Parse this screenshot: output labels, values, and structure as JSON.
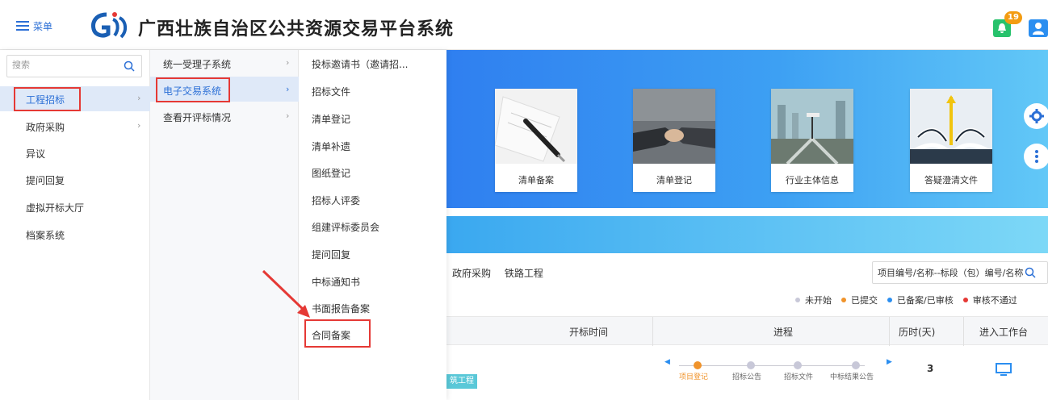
{
  "header": {
    "menu_label": "菜单",
    "site_title": "广西壮族自治区公共资源交易平台系统",
    "notification_count": "19"
  },
  "menu": {
    "search_placeholder": "搜索",
    "level1": [
      "工程招标",
      "政府采购",
      "异议",
      "提问回复",
      "虚拟开标大厅",
      "档案系统"
    ],
    "level2": [
      "统一受理子系统",
      "电子交易系统",
      "查看开评标情况"
    ],
    "level3": [
      "投标邀请书（邀请招...",
      "招标文件",
      "清单登记",
      "清单补遗",
      "图纸登记",
      "招标人评委",
      "组建评标委员会",
      "提问回复",
      "中标通知书",
      "书面报告备案",
      "合同备案"
    ]
  },
  "cards": [
    "清单备案",
    "清单登记",
    "行业主体信息",
    "答疑澄清文件"
  ],
  "tabs": [
    "政府采购",
    "铁路工程"
  ],
  "project_search_placeholder": "项目编号/名称--标段（包）编号/名称",
  "legend": [
    {
      "label": "未开始",
      "color": "#c8c8d8"
    },
    {
      "label": "已提交",
      "color": "#f0932b"
    },
    {
      "label": "已备案/已审核",
      "color": "#2b8ef0"
    },
    {
      "label": "审核不通过",
      "color": "#e53935"
    }
  ],
  "table": {
    "headers": [
      "开标时间",
      "进程",
      "历时(天)",
      "进入工作台"
    ],
    "row": {
      "tag": "筑工程",
      "progress_steps": [
        "项目登记",
        "招标公告",
        "招标文件",
        "中标结果公告"
      ],
      "days": "3"
    }
  },
  "colors": {
    "accent": "#2b6fd6",
    "highlight": "#e53935",
    "banner": "#3da0f3"
  }
}
